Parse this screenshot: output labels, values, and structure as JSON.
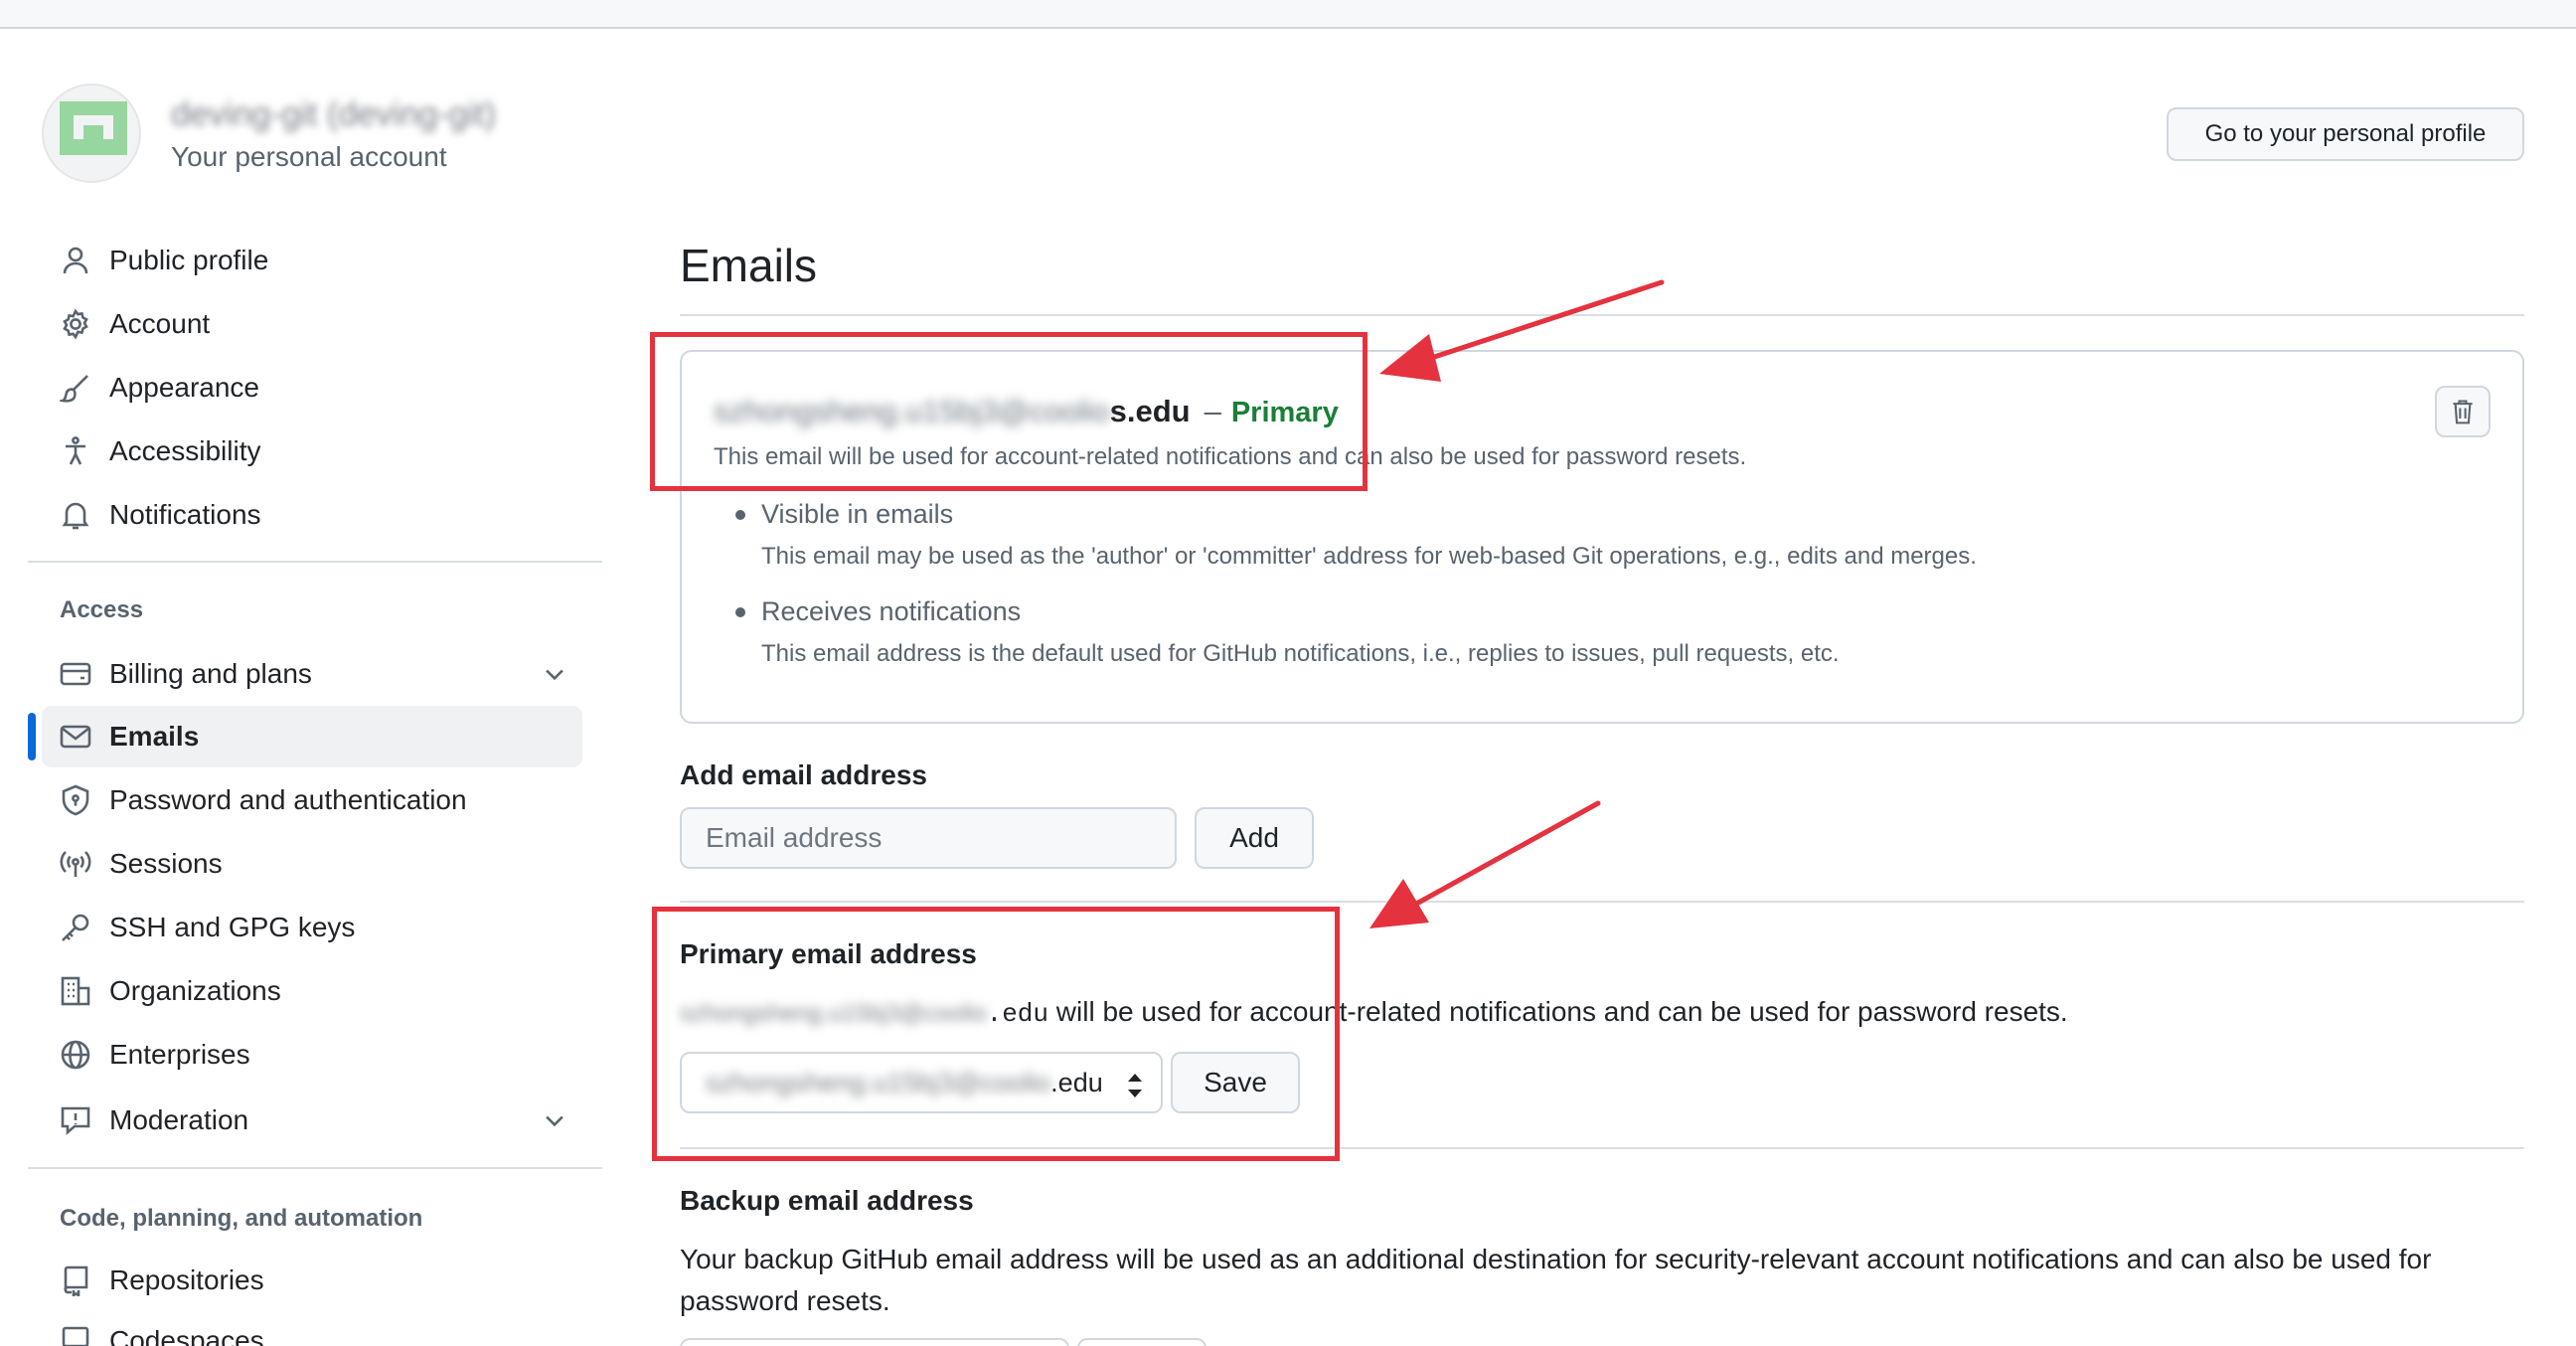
{
  "header": {
    "account_name": "deving-git (deving-git)",
    "account_sub": "Your personal account",
    "profile_button": "Go to your personal profile"
  },
  "sidebar": {
    "group1": [
      {
        "label": "Public profile",
        "icon": "person-icon"
      },
      {
        "label": "Account",
        "icon": "gear-icon"
      },
      {
        "label": "Appearance",
        "icon": "paintbrush-icon"
      },
      {
        "label": "Accessibility",
        "icon": "accessibility-icon"
      },
      {
        "label": "Notifications",
        "icon": "bell-icon"
      }
    ],
    "access_heading": "Access",
    "group2": [
      {
        "label": "Billing and plans",
        "icon": "credit-card-icon"
      },
      {
        "label": "Emails",
        "icon": "mail-icon"
      },
      {
        "label": "Password and authentication",
        "icon": "shield-lock-icon"
      },
      {
        "label": "Sessions",
        "icon": "broadcast-icon"
      },
      {
        "label": "SSH and GPG keys",
        "icon": "key-icon"
      },
      {
        "label": "Organizations",
        "icon": "organization-icon"
      },
      {
        "label": "Enterprises",
        "icon": "globe-icon"
      },
      {
        "label": "Moderation",
        "icon": "report-icon"
      }
    ],
    "code_heading": "Code, planning, and automation",
    "group3": [
      {
        "label": "Repositories",
        "icon": "repo-icon"
      },
      {
        "label": "Codespaces",
        "icon": "codespaces-icon"
      }
    ]
  },
  "main": {
    "title": "Emails",
    "email_card": {
      "address_blurred": "szhongsheng.u15bj3@coolio",
      "address_suffix": "s.edu",
      "dash": "–",
      "primary_label": "Primary",
      "description": "This email will be used for account-related notifications and can also be used for password resets.",
      "features": [
        {
          "title": "Visible in emails",
          "desc": "This email may be used as the 'author' or 'committer' address for web-based Git operations, e.g., edits and merges."
        },
        {
          "title": "Receives notifications",
          "desc": "This email address is the default used for GitHub notifications, i.e., replies to issues, pull requests, etc."
        }
      ]
    },
    "add_email": {
      "label": "Add email address",
      "placeholder": "Email address",
      "button": "Add"
    },
    "primary_email": {
      "label": "Primary email address",
      "text_blurred": "szhongsheng.u15bj3@coolio",
      "text_suffix": ".edu",
      "text_rest": " will be used for account-related notifications and can be used for password resets.",
      "select_blurred": "szhongsheng.u15bj3@coolio",
      "select_suffix": ".edu",
      "save_button": "Save"
    },
    "backup_email": {
      "label": "Backup email address",
      "text": "Your backup GitHub email address will be used as an additional destination for security-relevant account notifications and can also be used for password resets."
    }
  },
  "colors": {
    "accent": "#0969da",
    "primary_green": "#1a7f37",
    "annotation_red": "#e5323f"
  }
}
